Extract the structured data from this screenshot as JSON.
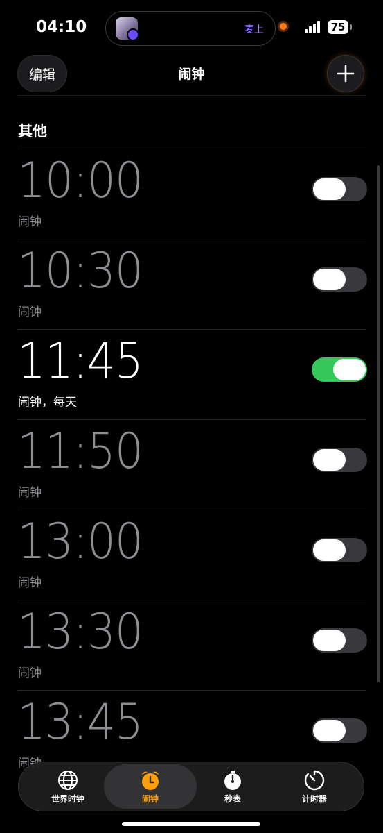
{
  "status_bar": {
    "time": "04:10",
    "island_label": "麦上",
    "battery": "75"
  },
  "nav": {
    "edit_label": "编辑",
    "title": "闹钟"
  },
  "section": {
    "title": "其他"
  },
  "alarms": [
    {
      "time": "10:00",
      "label": "闹钟",
      "enabled": false
    },
    {
      "time": "10:30",
      "label": "闹钟",
      "enabled": false
    },
    {
      "time": "11:45",
      "label": "闹钟，每天",
      "enabled": true
    },
    {
      "time": "11:50",
      "label": "闹钟",
      "enabled": false
    },
    {
      "time": "13:00",
      "label": "闹钟",
      "enabled": false
    },
    {
      "time": "13:30",
      "label": "闹钟",
      "enabled": false
    },
    {
      "time": "13:45",
      "label": "闹钟",
      "enabled": false
    }
  ],
  "tabs": [
    {
      "label": "世界时钟",
      "icon": "globe-icon",
      "active": false
    },
    {
      "label": "闹钟",
      "icon": "alarm-clock-icon",
      "active": true
    },
    {
      "label": "秒表",
      "icon": "stopwatch-icon",
      "active": false
    },
    {
      "label": "计时器",
      "icon": "timer-icon",
      "active": false
    }
  ],
  "colors": {
    "accent": "#ff9f0a",
    "toggle_on": "#34c759",
    "toggle_off": "#39393d",
    "inactive_text": "#8e8e93"
  }
}
